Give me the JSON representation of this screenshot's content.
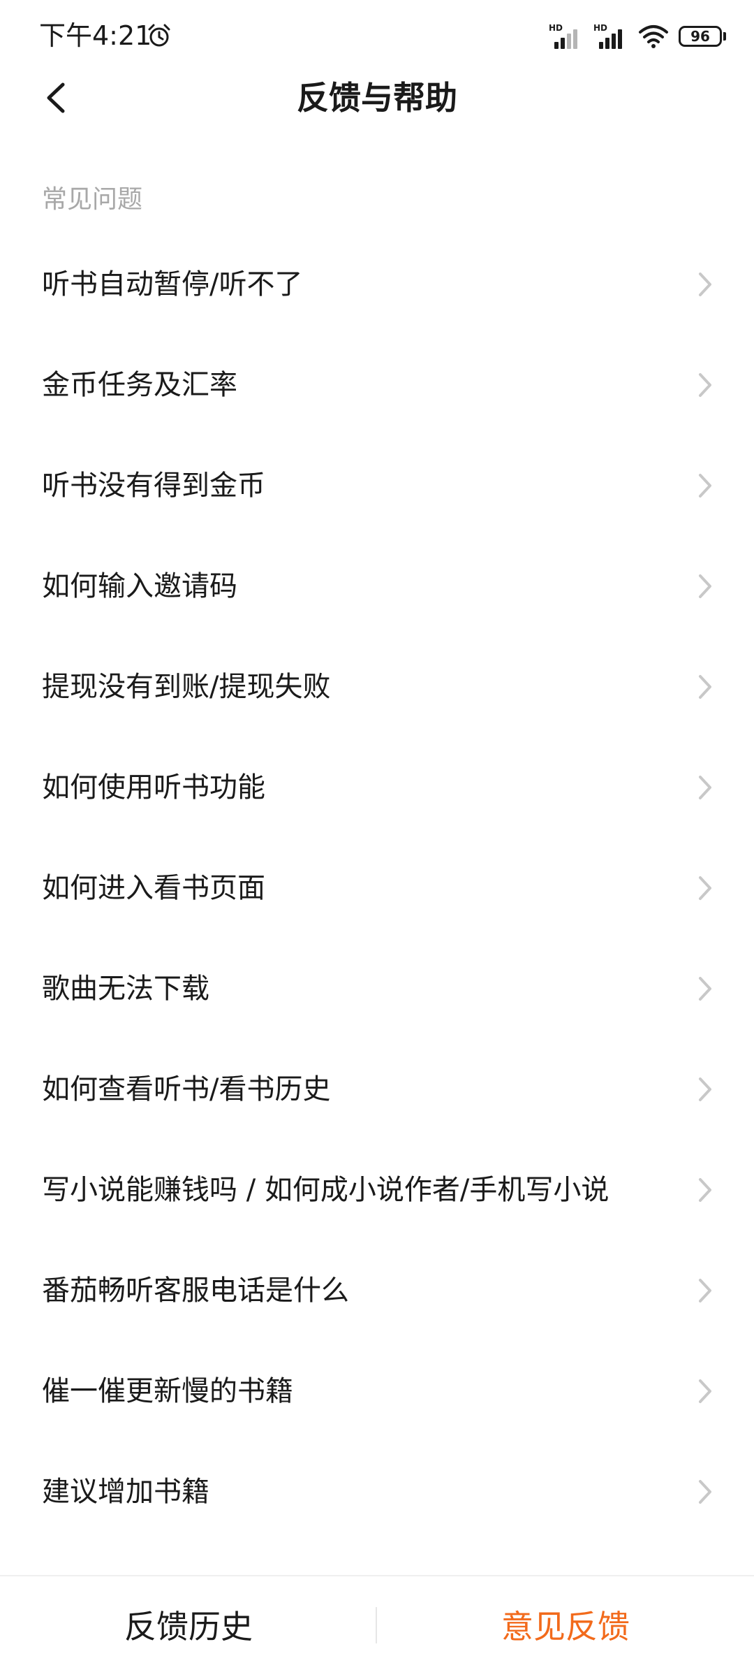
{
  "status_bar": {
    "time": "下午4:21",
    "signal_1_label": "HD",
    "signal_2_label": "HD",
    "battery": "96"
  },
  "header": {
    "title": "反馈与帮助"
  },
  "faq": {
    "section_title": "常见问题",
    "items": [
      {
        "label": "听书自动暂停/听不了"
      },
      {
        "label": "金币任务及汇率"
      },
      {
        "label": "听书没有得到金币"
      },
      {
        "label": "如何输入邀请码"
      },
      {
        "label": "提现没有到账/提现失败"
      },
      {
        "label": "如何使用听书功能"
      },
      {
        "label": "如何进入看书页面"
      },
      {
        "label": "歌曲无法下载"
      },
      {
        "label": "如何查看听书/看书历史"
      },
      {
        "label": "写小说能赚钱吗 / 如何成小说作者/手机写小说"
      },
      {
        "label": "番茄畅听客服电话是什么"
      },
      {
        "label": "催一催更新慢的书籍"
      },
      {
        "label": "建议增加书籍"
      }
    ]
  },
  "bottom_bar": {
    "history_label": "反馈历史",
    "feedback_label": "意见反馈"
  },
  "colors": {
    "accent": "#f26a1b",
    "text_primary": "#1a1a1a",
    "text_secondary": "#a8a8a8",
    "chevron": "#c8c8c8"
  }
}
